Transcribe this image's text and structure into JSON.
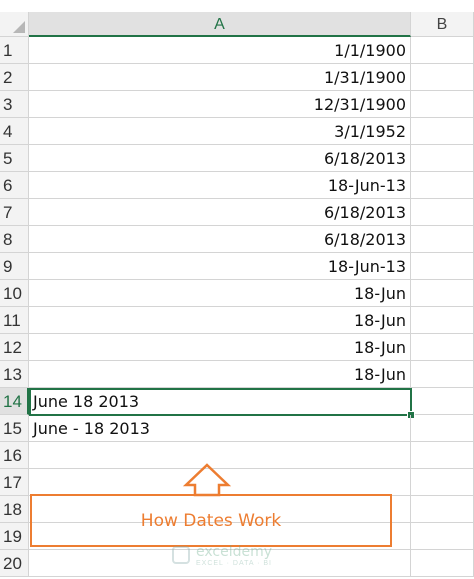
{
  "columns": [
    {
      "label": "A",
      "active": true
    },
    {
      "label": "B",
      "active": false
    }
  ],
  "rows": [
    {
      "num": "1",
      "a": "1/1/1900",
      "align": "right"
    },
    {
      "num": "2",
      "a": "1/31/1900",
      "align": "right"
    },
    {
      "num": "3",
      "a": "12/31/1900",
      "align": "right"
    },
    {
      "num": "4",
      "a": "3/1/1952",
      "align": "right"
    },
    {
      "num": "5",
      "a": "6/18/2013",
      "align": "right"
    },
    {
      "num": "6",
      "a": "18-Jun-13",
      "align": "right"
    },
    {
      "num": "7",
      "a": "6/18/2013",
      "align": "right"
    },
    {
      "num": "8",
      "a": "6/18/2013",
      "align": "right"
    },
    {
      "num": "9",
      "a": "18-Jun-13",
      "align": "right"
    },
    {
      "num": "10",
      "a": "18-Jun",
      "align": "right"
    },
    {
      "num": "11",
      "a": "18-Jun",
      "align": "right"
    },
    {
      "num": "12",
      "a": "18-Jun",
      "align": "right"
    },
    {
      "num": "13",
      "a": "18-Jun",
      "align": "right"
    },
    {
      "num": "14",
      "a": "June 18 2013",
      "align": "left"
    },
    {
      "num": "15",
      "a": "June - 18 2013",
      "align": "left"
    },
    {
      "num": "16",
      "a": "",
      "align": "left"
    },
    {
      "num": "17",
      "a": "",
      "align": "left"
    },
    {
      "num": "18",
      "a": "",
      "align": "left"
    },
    {
      "num": "19",
      "a": "",
      "align": "left"
    },
    {
      "num": "20",
      "a": "",
      "align": "left"
    }
  ],
  "selected_row": "14",
  "callout": {
    "label": "How Dates Work",
    "color": "#ed7d31"
  },
  "watermark": {
    "name": "exceldemy",
    "tagline": "EXCEL · DATA · BI"
  },
  "colors": {
    "accent": "#217346",
    "callout": "#ed7d31"
  }
}
